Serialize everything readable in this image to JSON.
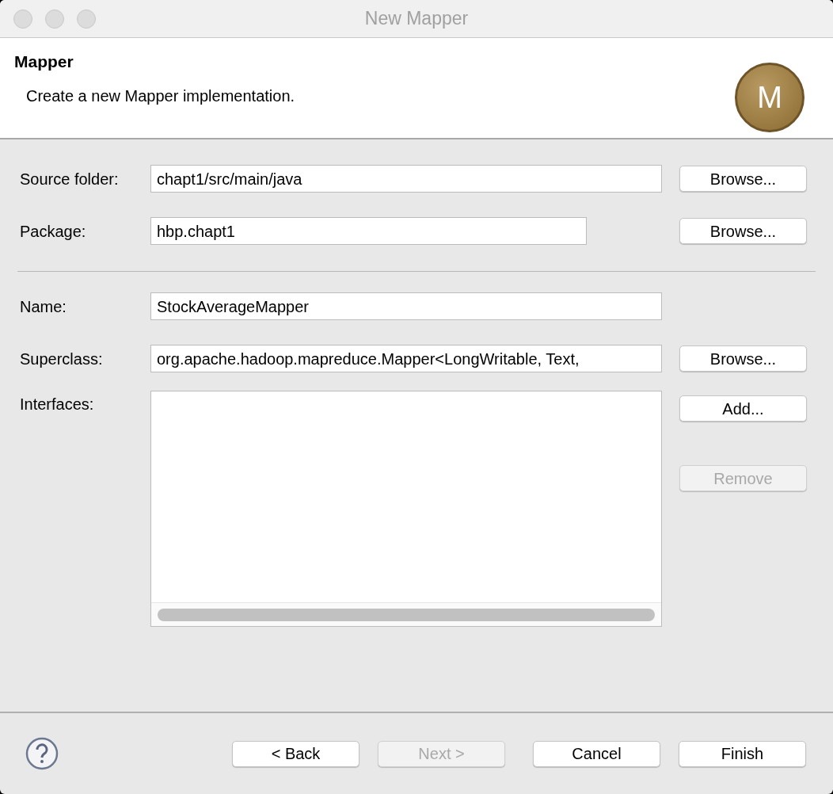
{
  "window": {
    "title": "New Mapper"
  },
  "header": {
    "title": "Mapper",
    "description": "Create a new Mapper implementation.",
    "badge": "M"
  },
  "groups": [
    {
      "fields": [
        {
          "label": "Source folder:",
          "value": "chapt1/src/main/java",
          "wide": true,
          "button": {
            "label": "Browse...",
            "disabled": false
          }
        },
        {
          "label": "Package:",
          "value": "hbp.chapt1",
          "wide": false,
          "button": {
            "label": "Browse...",
            "disabled": false
          }
        }
      ]
    },
    {
      "fields": [
        {
          "label": "Name:",
          "value": "StockAverageMapper",
          "wide": true
        },
        {
          "label": "Superclass:",
          "value": "org.apache.hadoop.mapreduce.Mapper<LongWritable, Text,",
          "wide": true,
          "button": {
            "label": "Browse...",
            "disabled": false
          }
        }
      ]
    }
  ],
  "interfaces": {
    "label": "Interfaces:",
    "buttons": [
      {
        "label": "Add...",
        "disabled": false
      },
      {
        "label": "Remove",
        "disabled": true
      }
    ]
  },
  "footer": {
    "buttons": [
      {
        "label": "< Back",
        "disabled": false
      },
      {
        "label": "Next >",
        "disabled": true
      },
      {
        "label": "Cancel",
        "disabled": false
      },
      {
        "label": "Finish",
        "disabled": false
      }
    ]
  }
}
